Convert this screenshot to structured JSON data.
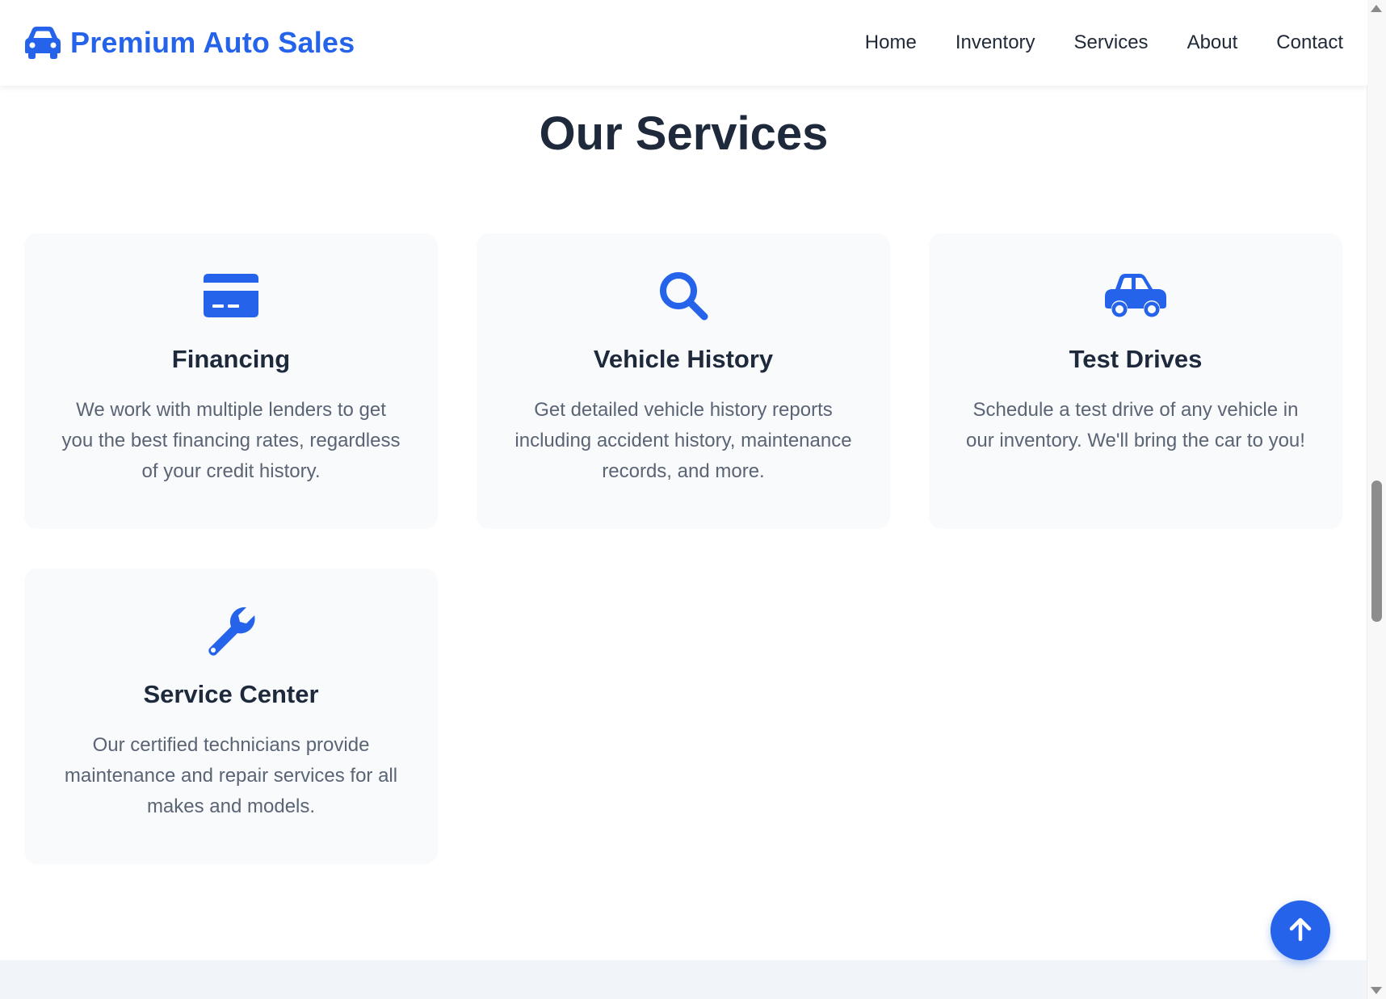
{
  "brand": {
    "name": "Premium Auto Sales",
    "icon": "car-icon",
    "color": "#2563eb"
  },
  "nav": {
    "items": [
      "Home",
      "Inventory",
      "Services",
      "About",
      "Contact"
    ]
  },
  "services": {
    "title": "Our Services",
    "cards": [
      {
        "icon": "credit-card-icon",
        "title": "Financing",
        "description": "We work with multiple lenders to get you the best financing rates, regardless of your credit history."
      },
      {
        "icon": "search-icon",
        "title": "Vehicle History",
        "description": "Get detailed vehicle history reports including accident history, maintenance records, and more."
      },
      {
        "icon": "car-icon",
        "title": "Test Drives",
        "description": "Schedule a test drive of any vehicle in our inventory. We'll bring the car to you!"
      },
      {
        "icon": "wrench-icon",
        "title": "Service Center",
        "description": "Our certified technicians provide maintenance and repair services for all makes and models."
      }
    ]
  },
  "back_to_top": {
    "icon": "arrow-up-icon"
  },
  "colors": {
    "accent": "#2563eb",
    "card_bg": "#f8fafc",
    "text_dark": "#1e293b",
    "text_muted": "#5b6474"
  }
}
